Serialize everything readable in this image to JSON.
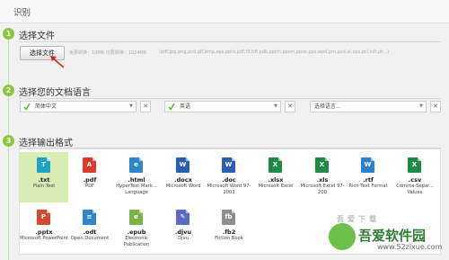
{
  "header": {
    "title": "识别"
  },
  "steps": [
    {
      "number": "1",
      "title": "选择文件"
    },
    {
      "number": "2",
      "title": "选择您的文档语言"
    },
    {
      "number": "3",
      "title": "选择输出格式"
    }
  ],
  "file_step": {
    "button_label": "选择文件",
    "hint_main": "免费转换：10MB  付费转换：1024MB",
    "hint_types": "(pdf,jpg,png,pcd,gif,bmp,eps,pptx,pdf,tif,tiff,pdb,pptm,ppsm,ppsx,pps,wpd,prn,psd,ai,xps,pcl,cdr,pt...)"
  },
  "language_step": {
    "selects": [
      {
        "label": "简体中文",
        "checked": true
      },
      {
        "label": "英语",
        "checked": true
      },
      {
        "label": "选择语言...",
        "checked": false
      }
    ],
    "clear_symbol": "✕",
    "arrow_symbol": "▼"
  },
  "formats": [
    {
      "ext": ".txt",
      "desc": "Plain Text",
      "color": "#1fa3c4",
      "icon": "txt-icon",
      "glyph": "T",
      "selected": true
    },
    {
      "ext": ".pdf",
      "desc": "PDF",
      "color": "#d93a2b",
      "icon": "pdf-icon",
      "glyph": "A",
      "selected": false
    },
    {
      "ext": ".html",
      "desc": "HyperText Mark... Language",
      "color": "#2d86c9",
      "icon": "html-icon",
      "glyph": "e",
      "selected": false
    },
    {
      "ext": ".docx",
      "desc": "Microsoft Word",
      "color": "#2b5fb4",
      "icon": "docx-icon",
      "glyph": "W",
      "selected": false
    },
    {
      "ext": ".doc",
      "desc": "Microsoft Word 97-2003",
      "color": "#2b5fb4",
      "icon": "doc-icon",
      "glyph": "W",
      "selected": false
    },
    {
      "ext": ".xlsx",
      "desc": "Microsoft Excel",
      "color": "#1e8a46",
      "icon": "xlsx-icon",
      "glyph": "X",
      "selected": false
    },
    {
      "ext": ".xls",
      "desc": "Microsoft Excel 97-200",
      "color": "#1e8a46",
      "icon": "xls-icon",
      "glyph": "X",
      "selected": false
    },
    {
      "ext": ".rtf",
      "desc": "Rich Text Format",
      "color": "#2d7fd0",
      "icon": "rtf-icon",
      "glyph": "W",
      "selected": false
    },
    {
      "ext": ".csv",
      "desc": "Comma-Separ... Values",
      "color": "#1e8a46",
      "icon": "csv-icon",
      "glyph": "X",
      "selected": false
    },
    {
      "ext": ".pptx",
      "desc": "Microsoft PowerPoint",
      "color": "#d2492b",
      "icon": "pptx-icon",
      "glyph": "P",
      "selected": false
    },
    {
      "ext": ".odt",
      "desc": "Open Document",
      "color": "#2d86c9",
      "icon": "odt-icon",
      "glyph": "≡",
      "selected": false
    },
    {
      "ext": ".epub",
      "desc": "Electronic Publication",
      "color": "#7cb342",
      "icon": "epub-icon",
      "glyph": "e",
      "selected": false
    },
    {
      "ext": ".djvu",
      "desc": "Djvu",
      "color": "#5c6bc0",
      "icon": "djvu-icon",
      "glyph": "✎",
      "selected": false
    },
    {
      "ext": ".fb2",
      "desc": "Fiction Book",
      "color": "#8d8d8d",
      "icon": "fb2-icon",
      "glyph": "fb",
      "selected": false
    }
  ],
  "watermark": {
    "text": "吾爱下载",
    "brand": "吾爱软件园",
    "url": "www.52zixue.com"
  },
  "colors": {
    "accent": "#8cc63f",
    "arrow": "#e02020",
    "selected_bg": "#d8ecb4"
  }
}
